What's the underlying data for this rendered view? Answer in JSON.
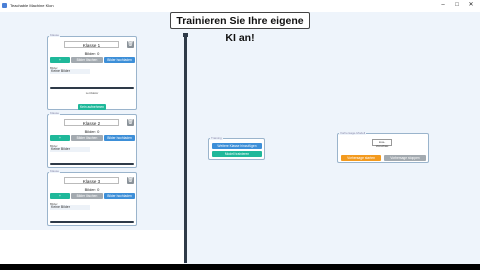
{
  "window": {
    "title": "Teachable Machine Klon",
    "controls": {
      "minimize": "–",
      "maximize": "□",
      "close": "✕"
    }
  },
  "heading": "Trainieren Sie Ihre eigene KI an!",
  "classes": [
    {
      "caption": "Klasse",
      "name": "Klasse 1",
      "count_label": "Bilder: 0",
      "delete_label": "🗑",
      "capture_label": "+",
      "delete_images_label": "Bilder löschen",
      "upload_label": "Bilder hochladen",
      "images_caption": "Bilder",
      "no_images_label": "Keine Bilder"
    },
    {
      "caption": "Klasse",
      "name": "Klasse 2",
      "count_label": "Bilder: 0",
      "delete_label": "🗑",
      "capture_label": "+",
      "delete_images_label": "Bilder löschen",
      "upload_label": "Bilder hochladen",
      "images_caption": "Bilder",
      "no_images_label": "Keine Bilder"
    },
    {
      "caption": "Klasse",
      "name": "Klasse 3",
      "count_label": "Bilder: 0",
      "delete_label": "🗑",
      "capture_label": "+",
      "delete_images_label": "Bilder löschen",
      "upload_label": "Bilder hochladen",
      "images_caption": "Bilder",
      "no_images_label": "Keine Bilder"
    }
  ],
  "panel1_extra": {
    "scale_label": "Lernfaktor",
    "model_button": "Kein aufnehmen"
  },
  "training": {
    "caption": "Training",
    "add_class_button": "Weitere Klasse hinzufügen",
    "train_button": "Modell trainieren"
  },
  "preview": {
    "caption": "Vorhersage-Modell",
    "field_label": "Live-Vorschau",
    "start_button": "Vorhersage starten",
    "stop_button": "Vorhersage stoppen"
  },
  "colors": {
    "teal": "#1fb89a",
    "blue": "#3d8fd8",
    "grey": "#a3aab0",
    "orange": "#f39a1e",
    "divider": "#2e3a48"
  }
}
